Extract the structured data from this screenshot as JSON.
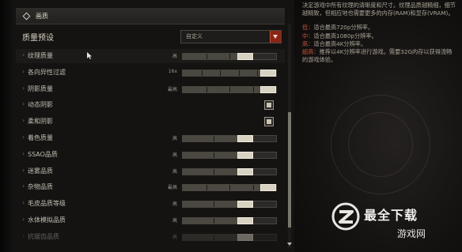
{
  "section": {
    "title": "画质"
  },
  "preset": {
    "label": "质量预设",
    "value": "自定义"
  },
  "settings": [
    {
      "label": "纹理质量",
      "value": "高",
      "type": "slider",
      "level": 0.75,
      "segments": 4
    },
    {
      "label": "各向异性过滤",
      "value": "16x",
      "type": "slider",
      "level": 1.0,
      "segments": 5
    },
    {
      "label": "阴影质量",
      "value": "最高",
      "type": "slider",
      "level": 1.0,
      "segments": 4
    },
    {
      "label": "动态阴影",
      "value": "",
      "type": "checkbox",
      "checked": true
    },
    {
      "label": "柔和阴影",
      "value": "",
      "type": "checkbox",
      "checked": true
    },
    {
      "label": "着色质量",
      "value": "高",
      "type": "slider",
      "level": 0.75,
      "segments": 3
    },
    {
      "label": "SSAO品质",
      "value": "高",
      "type": "slider",
      "level": 0.75,
      "segments": 3
    },
    {
      "label": "迷雾品质",
      "value": "高",
      "type": "slider",
      "level": 0.75,
      "segments": 3
    },
    {
      "label": "杂物品质",
      "value": "最高",
      "type": "slider",
      "level": 1.0,
      "segments": 4
    },
    {
      "label": "毛皮品质等级",
      "value": "高",
      "type": "slider",
      "level": 0.75,
      "segments": 3
    },
    {
      "label": "水体模拟品质",
      "value": "高",
      "type": "slider",
      "level": 0.75,
      "segments": 3
    },
    {
      "label": "抗锯齿品质",
      "value": "高",
      "type": "slider",
      "level": 0.75,
      "segments": 3
    }
  ],
  "description": {
    "intro": "决定游戏中所有纹理的清晰度和尺寸。纹理品质越精细，细节越精致，但相应地也需要更多的内存(RAM)和显存(VRAM)。",
    "levels": [
      {
        "key": "低：",
        "text": "适合最高720p分辨率。"
      },
      {
        "key": "中：",
        "text": "适合最高1080p分辨率。"
      },
      {
        "key": "高：",
        "text": "适合最高4K分辨率。"
      },
      {
        "key": "超高：",
        "text": "推荐以4K分辨率进行游戏。需要32G内存以获得流畅的游戏体验。"
      }
    ]
  },
  "watermark": {
    "title": "最全下载",
    "sub": "游戏网"
  },
  "colors": {
    "accent": "#8a2515",
    "level_key": "#c0553a"
  }
}
